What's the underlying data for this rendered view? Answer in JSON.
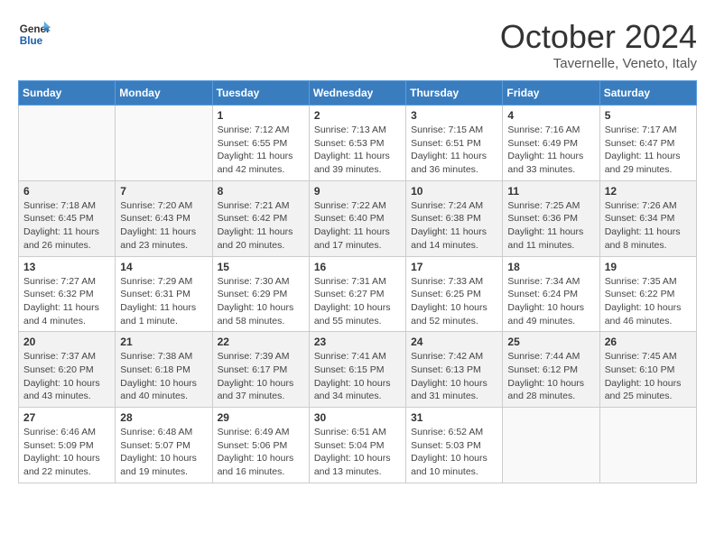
{
  "header": {
    "logo_line1": "General",
    "logo_line2": "Blue",
    "month": "October 2024",
    "location": "Tavernelle, Veneto, Italy"
  },
  "columns": [
    "Sunday",
    "Monday",
    "Tuesday",
    "Wednesday",
    "Thursday",
    "Friday",
    "Saturday"
  ],
  "weeks": [
    [
      {
        "day": "",
        "info": ""
      },
      {
        "day": "",
        "info": ""
      },
      {
        "day": "1",
        "info": "Sunrise: 7:12 AM\nSunset: 6:55 PM\nDaylight: 11 hours and 42 minutes."
      },
      {
        "day": "2",
        "info": "Sunrise: 7:13 AM\nSunset: 6:53 PM\nDaylight: 11 hours and 39 minutes."
      },
      {
        "day": "3",
        "info": "Sunrise: 7:15 AM\nSunset: 6:51 PM\nDaylight: 11 hours and 36 minutes."
      },
      {
        "day": "4",
        "info": "Sunrise: 7:16 AM\nSunset: 6:49 PM\nDaylight: 11 hours and 33 minutes."
      },
      {
        "day": "5",
        "info": "Sunrise: 7:17 AM\nSunset: 6:47 PM\nDaylight: 11 hours and 29 minutes."
      }
    ],
    [
      {
        "day": "6",
        "info": "Sunrise: 7:18 AM\nSunset: 6:45 PM\nDaylight: 11 hours and 26 minutes."
      },
      {
        "day": "7",
        "info": "Sunrise: 7:20 AM\nSunset: 6:43 PM\nDaylight: 11 hours and 23 minutes."
      },
      {
        "day": "8",
        "info": "Sunrise: 7:21 AM\nSunset: 6:42 PM\nDaylight: 11 hours and 20 minutes."
      },
      {
        "day": "9",
        "info": "Sunrise: 7:22 AM\nSunset: 6:40 PM\nDaylight: 11 hours and 17 minutes."
      },
      {
        "day": "10",
        "info": "Sunrise: 7:24 AM\nSunset: 6:38 PM\nDaylight: 11 hours and 14 minutes."
      },
      {
        "day": "11",
        "info": "Sunrise: 7:25 AM\nSunset: 6:36 PM\nDaylight: 11 hours and 11 minutes."
      },
      {
        "day": "12",
        "info": "Sunrise: 7:26 AM\nSunset: 6:34 PM\nDaylight: 11 hours and 8 minutes."
      }
    ],
    [
      {
        "day": "13",
        "info": "Sunrise: 7:27 AM\nSunset: 6:32 PM\nDaylight: 11 hours and 4 minutes."
      },
      {
        "day": "14",
        "info": "Sunrise: 7:29 AM\nSunset: 6:31 PM\nDaylight: 11 hours and 1 minute."
      },
      {
        "day": "15",
        "info": "Sunrise: 7:30 AM\nSunset: 6:29 PM\nDaylight: 10 hours and 58 minutes."
      },
      {
        "day": "16",
        "info": "Sunrise: 7:31 AM\nSunset: 6:27 PM\nDaylight: 10 hours and 55 minutes."
      },
      {
        "day": "17",
        "info": "Sunrise: 7:33 AM\nSunset: 6:25 PM\nDaylight: 10 hours and 52 minutes."
      },
      {
        "day": "18",
        "info": "Sunrise: 7:34 AM\nSunset: 6:24 PM\nDaylight: 10 hours and 49 minutes."
      },
      {
        "day": "19",
        "info": "Sunrise: 7:35 AM\nSunset: 6:22 PM\nDaylight: 10 hours and 46 minutes."
      }
    ],
    [
      {
        "day": "20",
        "info": "Sunrise: 7:37 AM\nSunset: 6:20 PM\nDaylight: 10 hours and 43 minutes."
      },
      {
        "day": "21",
        "info": "Sunrise: 7:38 AM\nSunset: 6:18 PM\nDaylight: 10 hours and 40 minutes."
      },
      {
        "day": "22",
        "info": "Sunrise: 7:39 AM\nSunset: 6:17 PM\nDaylight: 10 hours and 37 minutes."
      },
      {
        "day": "23",
        "info": "Sunrise: 7:41 AM\nSunset: 6:15 PM\nDaylight: 10 hours and 34 minutes."
      },
      {
        "day": "24",
        "info": "Sunrise: 7:42 AM\nSunset: 6:13 PM\nDaylight: 10 hours and 31 minutes."
      },
      {
        "day": "25",
        "info": "Sunrise: 7:44 AM\nSunset: 6:12 PM\nDaylight: 10 hours and 28 minutes."
      },
      {
        "day": "26",
        "info": "Sunrise: 7:45 AM\nSunset: 6:10 PM\nDaylight: 10 hours and 25 minutes."
      }
    ],
    [
      {
        "day": "27",
        "info": "Sunrise: 6:46 AM\nSunset: 5:09 PM\nDaylight: 10 hours and 22 minutes."
      },
      {
        "day": "28",
        "info": "Sunrise: 6:48 AM\nSunset: 5:07 PM\nDaylight: 10 hours and 19 minutes."
      },
      {
        "day": "29",
        "info": "Sunrise: 6:49 AM\nSunset: 5:06 PM\nDaylight: 10 hours and 16 minutes."
      },
      {
        "day": "30",
        "info": "Sunrise: 6:51 AM\nSunset: 5:04 PM\nDaylight: 10 hours and 13 minutes."
      },
      {
        "day": "31",
        "info": "Sunrise: 6:52 AM\nSunset: 5:03 PM\nDaylight: 10 hours and 10 minutes."
      },
      {
        "day": "",
        "info": ""
      },
      {
        "day": "",
        "info": ""
      }
    ]
  ]
}
